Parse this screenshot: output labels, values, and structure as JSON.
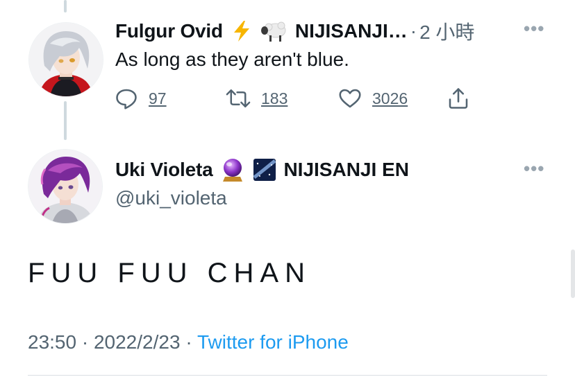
{
  "reply_tweet": {
    "display_name": "Fulgur Ovid",
    "name_emojis": [
      "lightning-icon",
      "sheep-icon"
    ],
    "affiliation": "NIJISANJI…",
    "separator": "·",
    "relative_time": "2 小時",
    "more_label": "•••",
    "text": "As long as they aren't blue.",
    "actions": {
      "reply_count": "97",
      "retweet_count": "183",
      "like_count": "3026"
    }
  },
  "main_tweet": {
    "display_name": "Uki Violeta",
    "name_emojis": [
      "crystal-ball-icon",
      "milky-way-icon"
    ],
    "affiliation": "NIJISANJI EN",
    "handle": "@uki_violeta",
    "more_label": "•••",
    "text": "FUU FUU CHAN",
    "time": "23:50",
    "date": "2022/2/23",
    "separator": "·",
    "source": "Twitter for iPhone"
  },
  "colors": {
    "text_primary": "#0f1419",
    "text_secondary": "#536471",
    "link": "#1d9bf0",
    "thread_line": "#cfd9de"
  }
}
